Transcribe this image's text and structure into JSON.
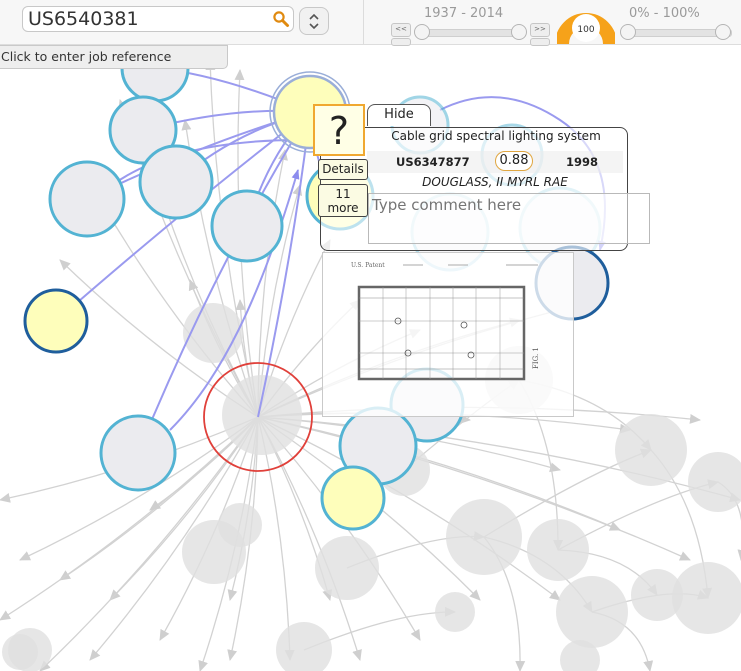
{
  "search": {
    "value": "US6540381",
    "icon": "search-icon"
  },
  "year_range": {
    "label": "1937 - 2014",
    "min": 1937,
    "max": 2014,
    "low": 1937,
    "high": 2014
  },
  "score_gauge": {
    "value": "100",
    "fraction": 1.0,
    "color": "#f6a21a"
  },
  "percent_range": {
    "label": "0% - 100%",
    "low": 0.0,
    "high": 1.0
  },
  "step_buttons": {
    "prev": "<<",
    "next": ">>"
  },
  "job_reference": {
    "placeholder": "Click to enter job reference"
  },
  "popup": {
    "hide_label": "Hide",
    "title": "Cable grid spectral lighting system",
    "patent_number": "US6347877",
    "score": "0.88",
    "year": "1998",
    "author": "DOUGLASS, II MYRL RAE",
    "comment_placeholder": "Type comment here",
    "question_mark": "?",
    "details_label": "Details",
    "more_label": "11 more"
  },
  "patent_image": {
    "header_left": "U.S. Patent",
    "figure_label": "FIG. 1"
  },
  "colors": {
    "node_blue_stroke": "#53b3d3",
    "node_dark_stroke": "#1f5e9c",
    "node_fill": "#ebebef",
    "node_yellow_fill": "#fefebb",
    "node_grey": "#e0e0e0",
    "edge_purple": "#9d9df2",
    "focus_red": "#e0403a",
    "accent_orange": "#f6a21a"
  }
}
